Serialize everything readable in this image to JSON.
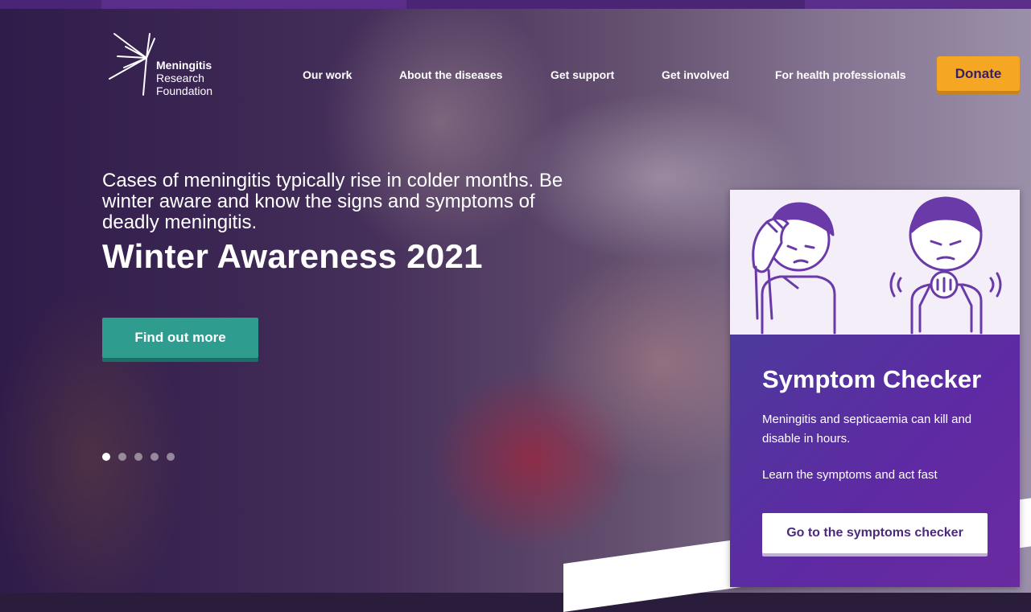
{
  "brand": {
    "logo_lines": [
      "Meningitis",
      "Research",
      "Foundation"
    ],
    "logo_icon": "starburst-icon"
  },
  "nav": {
    "items": [
      {
        "label": "Our work"
      },
      {
        "label": "About the diseases"
      },
      {
        "label": "Get support"
      },
      {
        "label": "Get involved"
      },
      {
        "label": "For health professionals"
      }
    ],
    "donate_label": "Donate"
  },
  "hero": {
    "intro": "Cases of meningitis typically rise in colder months. Be winter aware and know the signs and symptoms of deadly meningitis.",
    "title": "Winter Awareness 2021",
    "cta_label": "Find out more",
    "slide_count": 5,
    "active_slide": 1
  },
  "symptom_card": {
    "title": "Symptom Checker",
    "description": "Meningitis and septicaemia can kill and disable in hours.",
    "subtext": "Learn the symptoms and act fast",
    "button_label": "Go to the symptoms checker",
    "illustration": "symptom-figures-icon"
  },
  "colors": {
    "top_bar": "#5a2d8a",
    "donate": "#f5a623",
    "cta": "#2e9c8f",
    "card_purple": "#5e2aa3",
    "illustration_stroke": "#6a3aa8"
  }
}
